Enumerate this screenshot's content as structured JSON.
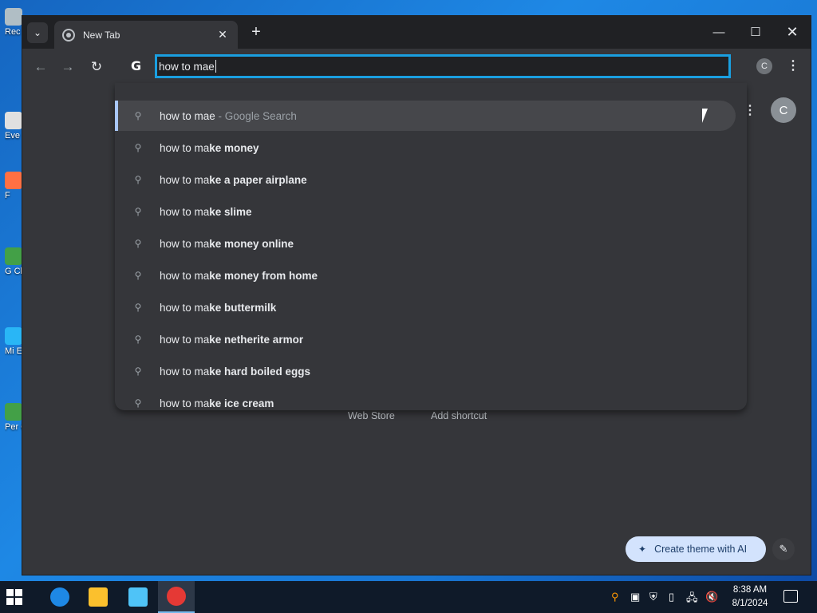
{
  "desktop": {
    "icons": [
      {
        "label": "Rec",
        "color": "#b0bec5"
      },
      {
        "label": "Eve",
        "color": "#e0e0e0"
      },
      {
        "label": "F",
        "color": "#ff7043"
      },
      {
        "label": "G Ch",
        "color": "#43a047"
      },
      {
        "label": "Mi E",
        "color": "#29b6f6"
      },
      {
        "label": "Per Ch",
        "color": "#43a047"
      }
    ]
  },
  "browser": {
    "tab_title": "New Tab",
    "tab_close": "✕",
    "new_tab": "+",
    "window_min": "—",
    "window_max": "☐",
    "window_close": "✕",
    "nav_back": "←",
    "nav_forward": "→",
    "nav_reload": "↻",
    "search_engine_logo": "G",
    "omnibox_value": "how to mae",
    "profile_initial": "C",
    "menu_icon": "⋮"
  },
  "ntp": {
    "menu_icon": "⋮",
    "avatar_initial": "C",
    "shortcuts": [
      "Web Store",
      "Add shortcut"
    ],
    "create_theme_label": "Create theme with AI",
    "create_theme_icon": "✦",
    "edit_icon": "✎"
  },
  "suggestions": [
    {
      "typed": "how to mae",
      "bold": "",
      "suffix": " - Google Search",
      "selected": true
    },
    {
      "typed": "how to ma",
      "bold": "ke money",
      "suffix": "",
      "selected": false
    },
    {
      "typed": "how to ma",
      "bold": "ke a paper airplane",
      "suffix": "",
      "selected": false
    },
    {
      "typed": "how to ma",
      "bold": "ke slime",
      "suffix": "",
      "selected": false
    },
    {
      "typed": "how to ma",
      "bold": "ke money online",
      "suffix": "",
      "selected": false
    },
    {
      "typed": "how to ma",
      "bold": "ke money from home",
      "suffix": "",
      "selected": false
    },
    {
      "typed": "how to ma",
      "bold": "ke buttermilk",
      "suffix": "",
      "selected": false
    },
    {
      "typed": "how to ma",
      "bold": "ke netherite armor",
      "suffix": "",
      "selected": false
    },
    {
      "typed": "how to ma",
      "bold": "ke hard boiled eggs",
      "suffix": "",
      "selected": false
    },
    {
      "typed": "how to ma",
      "bold": "ke ice cream",
      "suffix": "",
      "selected": false
    }
  ],
  "suggestion_icon": "search-icon",
  "taskbar": {
    "apps": [
      {
        "name": "edge",
        "color": "#1e88e5",
        "active": false
      },
      {
        "name": "file-explorer",
        "color": "#fbc02d",
        "active": false
      },
      {
        "name": "remote-desktop",
        "color": "#4fc3f7",
        "active": false
      },
      {
        "name": "chrome",
        "color": "#e53935",
        "active": true
      }
    ],
    "time": "8:38 AM",
    "date": "8/1/2024"
  },
  "colors": {
    "accent": "#1a9fe0",
    "window_bg": "#35363a",
    "titlebar_bg": "#202124",
    "desktop": "#1976d2"
  }
}
